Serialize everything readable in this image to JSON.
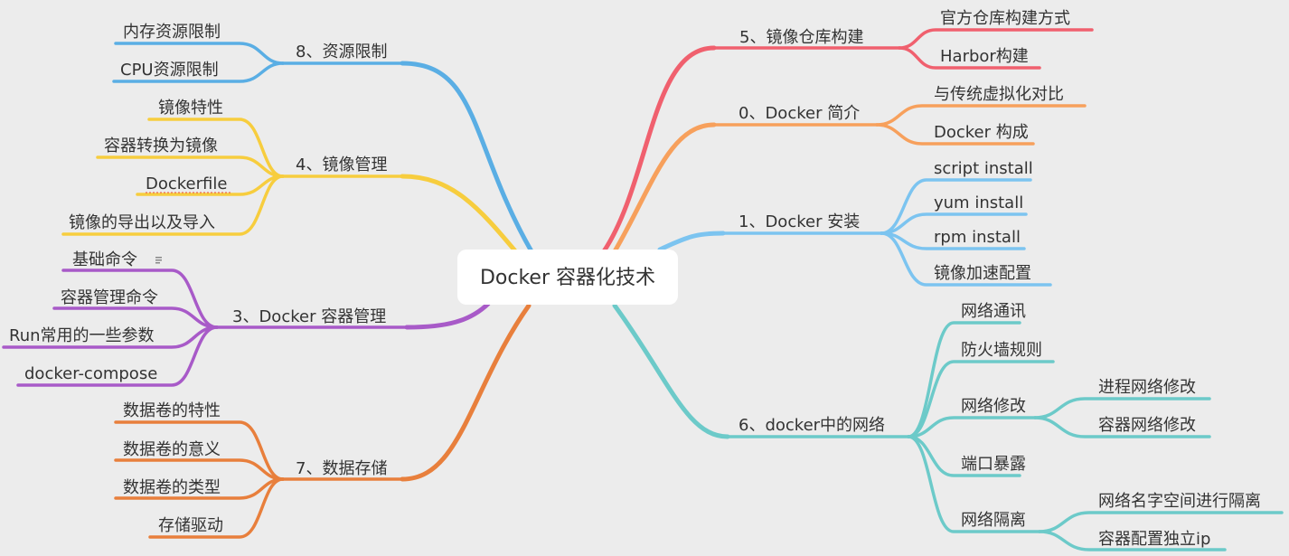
{
  "root": {
    "label": "Docker 容器化技术"
  },
  "colors": {
    "red": "#f0606e",
    "orange": "#f7a05c",
    "sky": "#7cc4f0",
    "teal": "#6ccac9",
    "blue": "#5aaee4",
    "yellow": "#f7cd3e",
    "purple": "#a85ac8",
    "brown": "#e87f3c",
    "root_bg": "#ffffff",
    "canvas_bg": "#ececec"
  },
  "branches": {
    "b5": {
      "label": "5、镜像仓库构建",
      "children": [
        "官方仓库构建方式",
        "Harbor构建"
      ]
    },
    "b0": {
      "label": "0、Docker 简介",
      "children": [
        "与传统虚拟化对比",
        "Docker 构成"
      ]
    },
    "b1": {
      "label": "1、Docker 安装",
      "children": [
        "script install",
        "yum install",
        "rpm install",
        "镜像加速配置"
      ]
    },
    "b6": {
      "label": "6、docker中的网络",
      "children": [
        "网络通讯",
        "防火墙规则",
        "网络修改",
        "端口暴露",
        "网络隔离"
      ],
      "sub_network_modify": [
        "进程网络修改",
        "容器网络修改"
      ],
      "sub_network_isolation": [
        "网络名字空间进行隔离",
        "容器配置独立ip"
      ]
    },
    "b8": {
      "label": "8、资源限制",
      "children": [
        "内存资源限制",
        "CPU资源限制"
      ]
    },
    "b4": {
      "label": "4、镜像管理",
      "children": [
        "镜像特性",
        "容器转换为镜像",
        "Dockerfile",
        "镜像的导出以及导入"
      ]
    },
    "b3": {
      "label": "3、Docker 容器管理",
      "children": [
        "基础命令",
        "容器管理命令",
        "Run常用的一些参数",
        "docker-compose"
      ],
      "note_icon": "note-icon"
    },
    "b7": {
      "label": "7、数据存储",
      "children": [
        "数据卷的特性",
        "数据卷的意义",
        "数据卷的类型",
        "存储驱动"
      ]
    }
  }
}
